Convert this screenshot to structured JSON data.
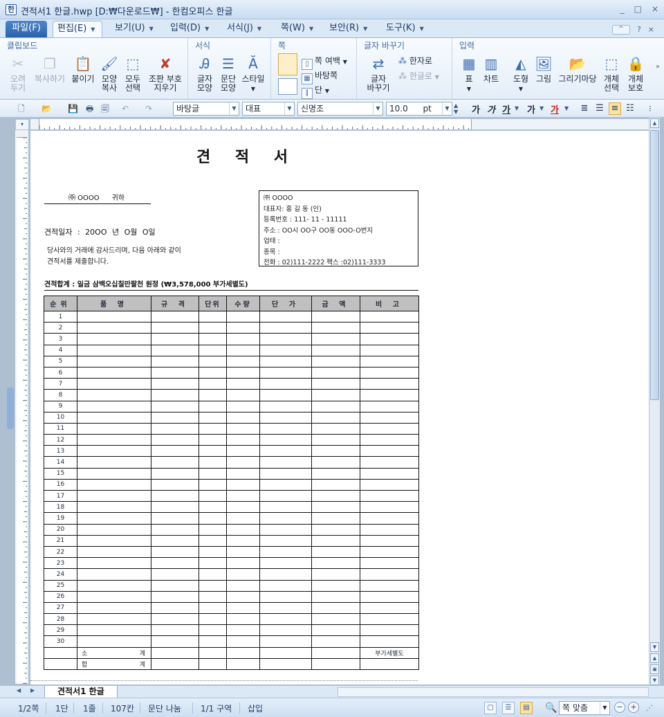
{
  "window": {
    "title": "견적서1 한글.hwp [D:₩다운로드₩] - 한컴오피스 한글",
    "controls": [
      "_",
      "□",
      "×"
    ]
  },
  "menu_tabs": [
    {
      "label": "파일(F)"
    },
    {
      "label": "편집(E)"
    },
    {
      "label": "보기(U)"
    },
    {
      "label": "입력(D)"
    },
    {
      "label": "서식(J)"
    },
    {
      "label": "쪽(W)"
    },
    {
      "label": "보안(R)"
    },
    {
      "label": "도구(K)"
    }
  ],
  "menu_right": [
    "^",
    "?",
    "×"
  ],
  "ribbon": {
    "groups": [
      "클립보드",
      "서식",
      "쪽",
      "글자 바꾸기",
      "입력"
    ],
    "clipboard": {
      "cut": "오려\n두기",
      "copy": "복사하기",
      "paste": "붙이기",
      "format_copy": "모양\n복사",
      "select_all": "모두\n선택",
      "clear_code": "조판 부호\n지우기"
    },
    "format": {
      "char_shape": "글자\n모양",
      "para_shape": "문단\n모양",
      "style": "스타일"
    },
    "page": {
      "page_margin": "쪽 여백",
      "background": "바탕쪽",
      "columns": "단"
    },
    "convert": {
      "change_char": "글자\n바꾸기",
      "to_hanja": "한자로",
      "to_hangul": "한글로"
    },
    "insert": {
      "table": "표",
      "chart": "차트",
      "shape": "도형",
      "picture": "그림",
      "drawing": "그리기마당",
      "object_select": "개체\n선택",
      "object_protect": "개체\n보호"
    }
  },
  "toolbar": {
    "style": "바탕글",
    "lang": "대표",
    "font": "신명조",
    "size": "10.0",
    "size_unit": "pt",
    "bold": "가",
    "italic": "가",
    "underline": "가",
    "strike": "가",
    "color": "가"
  },
  "document": {
    "title": "견 적 서",
    "recipient_company": "㈜ OOOO",
    "recipient_suffix": "귀하",
    "date_line": "견적일자 :   20OO 년   O월    O일",
    "greeting_1": "당사와의 거래에 감사드리며, 다음 아래와 같이",
    "greeting_2": "견적서를 제출합니다.",
    "company_box": [
      "㈜ OOOO",
      "대표자:  홍 길 동 (인)",
      "등록번호 :      111- 11 - 11111",
      "주소 : OO시 OO구 OO동 OOO-O번지",
      "업태 :",
      "종목 :",
      "전화 : 02)111-2222     팩스 :02)111-3333"
    ],
    "total_line": "견적합계 : 일금   삼백오십칠만팔천 원정 (₩3,578,000   부가세별도)",
    "columns": [
      "순위",
      "품  명",
      "규 격",
      "단위",
      "수량",
      "단 가",
      "금 액",
      "비 고"
    ],
    "rows": [
      "1",
      "2",
      "3",
      "4",
      "5",
      "6",
      "7",
      "8",
      "9",
      "10",
      "11",
      "12",
      "13",
      "14",
      "15",
      "16",
      "17",
      "18",
      "19",
      "20",
      "21",
      "22",
      "23",
      "24",
      "25",
      "26",
      "27",
      "28",
      "29",
      "30"
    ],
    "subtotal_label": "소",
    "subtotal_suffix": "계",
    "vat_note": "부가세별도",
    "sum_label": "합",
    "sum_suffix": "계"
  },
  "doc_tab": "견적서1 한글",
  "status": {
    "page": "1/2쪽",
    "col": "1단",
    "line": "1줄",
    "char": "107칸",
    "para": "문단 나눔",
    "section": "1/1 구역",
    "mode": "삽입",
    "zoom": "쪽 맞춤"
  }
}
